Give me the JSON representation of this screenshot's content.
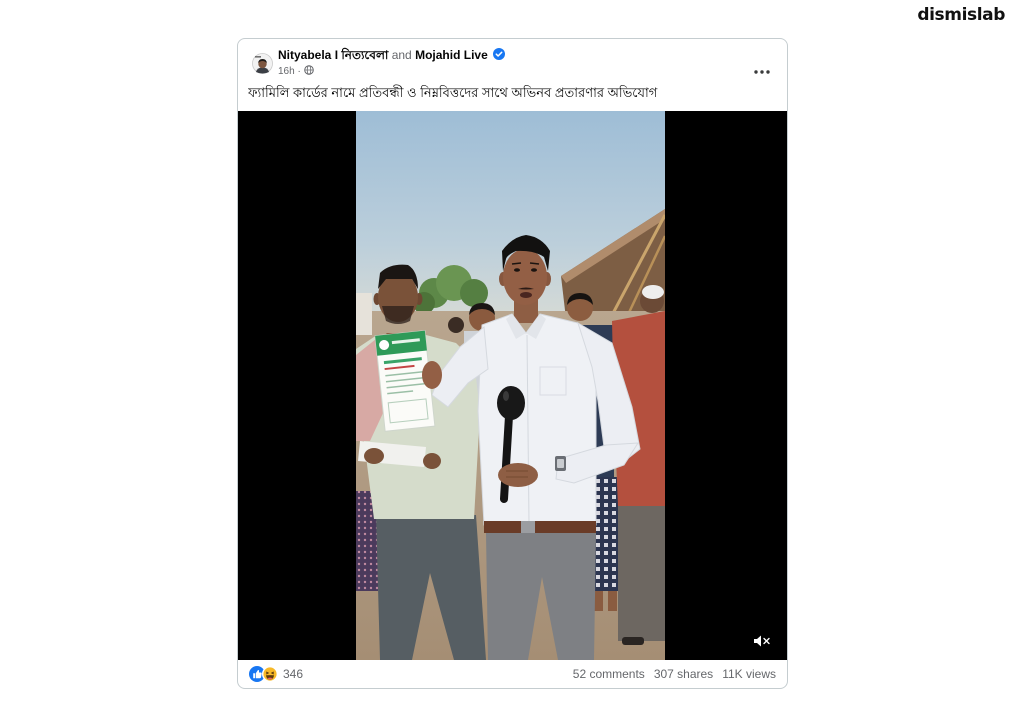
{
  "colors": {
    "page_background": "#ffffff",
    "card_border": "#c5cdd0",
    "primary_text": "#050505",
    "secondary_text": "#65676b",
    "verified_blue": "#1877f2",
    "like_blue": "#1877f2",
    "haha_yellow": "#f7b928",
    "video_letterbox": "#000000"
  },
  "brand": {
    "logo_text": "dismislab"
  },
  "post": {
    "header": {
      "page_name": "Nityabela I নিত্যবেলা",
      "connector": "and",
      "coauthor_name": "Mojahid Live",
      "verified_icon": "verified-badge-icon",
      "time": "16h",
      "separator": "·",
      "audience_icon": "globe-icon",
      "more_icon": "more-options-icon"
    },
    "caption": "ফ্যামিলি কার্ডের নামে প্রতিবন্ধী ও নিম্নবিত্তদের সাথে অভিনব প্রতারণার অভিযোগ",
    "video": {
      "muted": true,
      "mute_icon": "speaker-muted-icon"
    },
    "footer": {
      "reaction_icons": [
        "like-icon",
        "haha-icon"
      ],
      "reaction_count": "346",
      "comments": "52 comments",
      "shares": "307 shares",
      "views": "11K views"
    }
  }
}
